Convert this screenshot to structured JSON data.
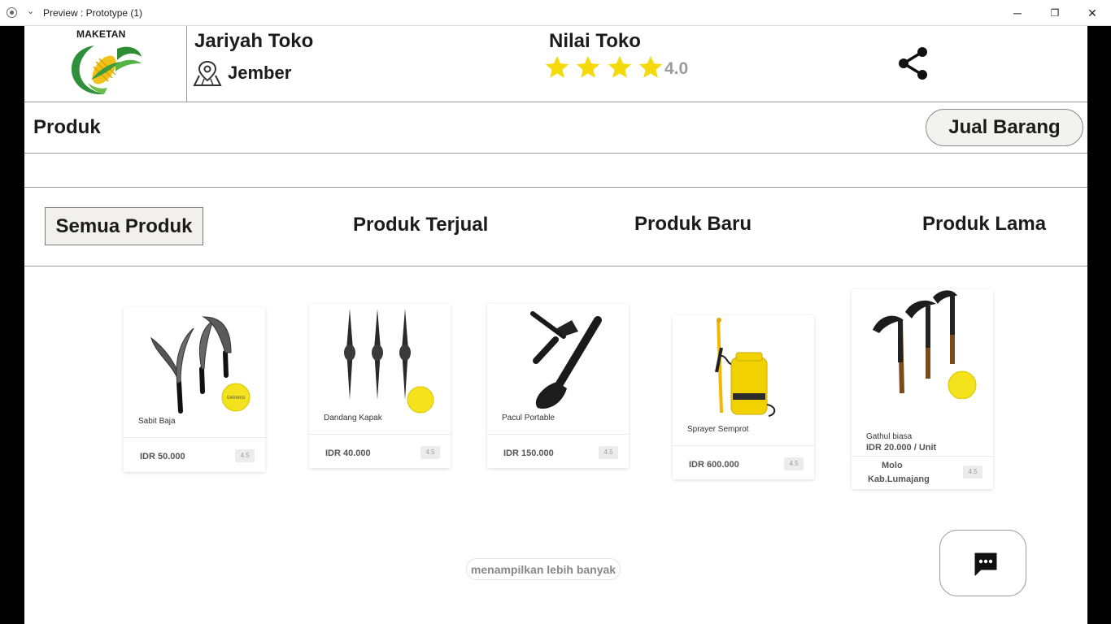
{
  "window": {
    "title": "Preview : Prototype (1)",
    "minimize_glyph": "─",
    "maximize_glyph": "❐",
    "close_glyph": "✕"
  },
  "logo": {
    "text": "MAKETAN",
    "icon": "corn-leaf-logo-icon"
  },
  "store": {
    "name": "Jariyah Toko",
    "location": "Jember",
    "location_icon": "map-pin-icon"
  },
  "rating": {
    "title": "Nilai Toko",
    "stars": 4,
    "value": "4.0",
    "star_color": "#F5D90A"
  },
  "share_icon": "share-icon",
  "products_section": {
    "title": "Produk",
    "sell_button": "Jual Barang"
  },
  "tabs": [
    {
      "label": "Semua Produk",
      "active": true
    },
    {
      "label": "Produk Terjual",
      "active": false
    },
    {
      "label": "Produk Baru",
      "active": false
    },
    {
      "label": "Produk Lama",
      "active": false
    }
  ],
  "products": [
    {
      "name": "Sabit Baja",
      "price": "IDR 50.000",
      "rating": "4.5",
      "image": "sickle-icon"
    },
    {
      "name": "Dandang Kapak",
      "price": "IDR 40.000",
      "rating": "4.5",
      "image": "pickaxe-icon"
    },
    {
      "name": "Pacul Portable",
      "price": "IDR 150.000",
      "rating": "4.5",
      "image": "folding-shovel-icon"
    },
    {
      "name": "Sprayer Semprot",
      "price": "IDR 600.000",
      "rating": "4.5",
      "image": "sprayer-icon"
    },
    {
      "name": "Gathul biasa",
      "price": "IDR 20.000 / Unit",
      "location_line1": "Molo",
      "location_line2": "Kab.Lumajang",
      "rating": "4.5",
      "image": "hoe-icon"
    }
  ],
  "show_more": "menampilkan lebih banyak",
  "chat_icon": "chat-bubble-icon"
}
